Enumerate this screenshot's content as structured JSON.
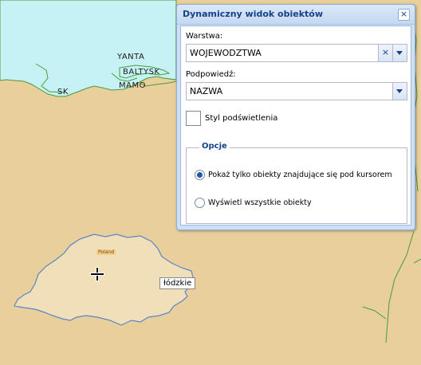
{
  "window": {
    "title": "Dynamiczny widok obiektów",
    "close_label": "×"
  },
  "layer": {
    "label": "Warstwa:",
    "value": "WOJEWODZTWA",
    "clear_label": "×"
  },
  "hint": {
    "label": "Podpowiedź:",
    "value": "NAZWA"
  },
  "highlight_style": {
    "label": "Styl podświetlenia"
  },
  "options": {
    "legend": "Opcje",
    "radio_under_cursor": "Pokaż tylko obiekty znajdujące się pod kursorem",
    "radio_all": "Wyświetl wszystkie obiekty",
    "selected": "radio_under_cursor"
  },
  "map": {
    "labels": [
      "YANTA",
      "BALTYSK",
      "MAMO",
      "SK"
    ],
    "country_tag": "Poland",
    "tooltip": "łódzkie",
    "colors": {
      "land": "#e8cf9c",
      "sea": "#c6f2f6",
      "region_fill": "#f0dfb8",
      "region_border": "#5b86c7",
      "boundary": "#4a9a3a"
    }
  }
}
